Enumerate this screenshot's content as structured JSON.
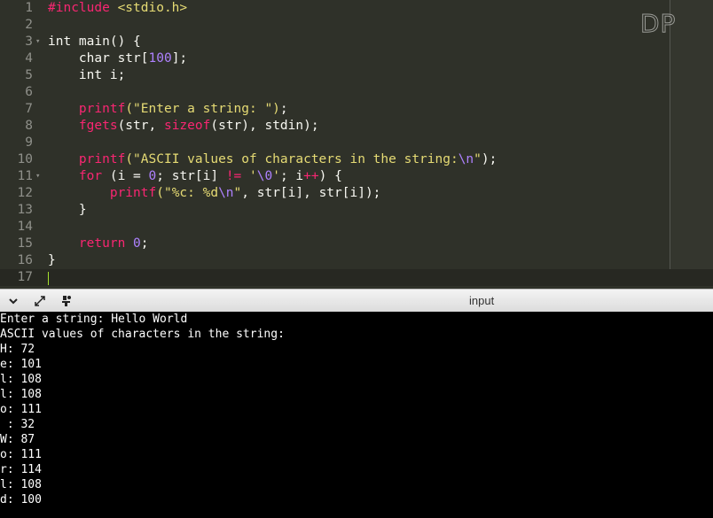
{
  "editor": {
    "watermark": "DP",
    "lines": [
      {
        "n": "1",
        "fold": "",
        "tokens": [
          [
            "pre",
            "#include "
          ],
          [
            "inc",
            "<stdio.h>"
          ]
        ]
      },
      {
        "n": "2",
        "fold": "",
        "tokens": []
      },
      {
        "n": "3",
        "fold": "▾",
        "tokens": [
          [
            "",
            "int main() {"
          ]
        ]
      },
      {
        "n": "4",
        "fold": "",
        "tokens": [
          [
            "",
            "    char str["
          ],
          [
            "num",
            "100"
          ],
          [
            "",
            "];"
          ]
        ]
      },
      {
        "n": "5",
        "fold": "",
        "tokens": [
          [
            "",
            "    int i;"
          ]
        ]
      },
      {
        "n": "6",
        "fold": "",
        "tokens": []
      },
      {
        "n": "7",
        "fold": "",
        "tokens": [
          [
            "",
            "    "
          ],
          [
            "fn",
            "printf"
          ],
          [
            "str",
            "(\"Enter a string: \")"
          ],
          [
            "",
            ";"
          ]
        ]
      },
      {
        "n": "8",
        "fold": "",
        "tokens": [
          [
            "",
            "    "
          ],
          [
            "fn",
            "fgets"
          ],
          [
            "",
            "(str, "
          ],
          [
            "fn",
            "sizeof"
          ],
          [
            "",
            "(str), stdin);"
          ]
        ]
      },
      {
        "n": "9",
        "fold": "",
        "tokens": []
      },
      {
        "n": "10",
        "fold": "",
        "tokens": [
          [
            "",
            "    "
          ],
          [
            "fn",
            "printf"
          ],
          [
            "str",
            "(\"ASCII values of characters in the string:"
          ],
          [
            "esc",
            "\\n"
          ],
          [
            "str",
            "\""
          ],
          [
            "",
            ");"
          ]
        ]
      },
      {
        "n": "11",
        "fold": "▾",
        "tokens": [
          [
            "",
            "    "
          ],
          [
            "kw",
            "for"
          ],
          [
            "",
            " (i = "
          ],
          [
            "num",
            "0"
          ],
          [
            "",
            "; str[i] "
          ],
          [
            "kw",
            "!="
          ],
          [
            "",
            " "
          ],
          [
            "str",
            "'"
          ],
          [
            "esc",
            "\\0"
          ],
          [
            "str",
            "'"
          ],
          [
            "",
            "; i"
          ],
          [
            "kw",
            "++"
          ],
          [
            "",
            ") {"
          ]
        ]
      },
      {
        "n": "12",
        "fold": "",
        "tokens": [
          [
            "",
            "        "
          ],
          [
            "fn",
            "printf"
          ],
          [
            "str",
            "(\"%c: %d"
          ],
          [
            "esc",
            "\\n"
          ],
          [
            "str",
            "\""
          ],
          [
            "",
            ", str[i], str[i]);"
          ]
        ]
      },
      {
        "n": "13",
        "fold": "",
        "tokens": [
          [
            "",
            "    }"
          ]
        ]
      },
      {
        "n": "14",
        "fold": "",
        "tokens": []
      },
      {
        "n": "15",
        "fold": "",
        "tokens": [
          [
            "",
            "    "
          ],
          [
            "kw",
            "return"
          ],
          [
            "",
            " "
          ],
          [
            "num",
            "0"
          ],
          [
            "",
            ";"
          ]
        ]
      },
      {
        "n": "16",
        "fold": "",
        "tokens": [
          [
            "",
            "}"
          ]
        ]
      },
      {
        "n": "17",
        "fold": "",
        "tokens": []
      }
    ]
  },
  "console_bar": {
    "label": "input",
    "icons": [
      "chevron-down-icon",
      "expand-icon",
      "settings-icon"
    ]
  },
  "console": {
    "lines": [
      "Enter a string: Hello World",
      "ASCII values of characters in the string:",
      "H: 72",
      "e: 101",
      "l: 108",
      "l: 108",
      "o: 111",
      " : 32",
      "W: 87",
      "o: 111",
      "r: 114",
      "l: 108",
      "d: 100"
    ]
  }
}
